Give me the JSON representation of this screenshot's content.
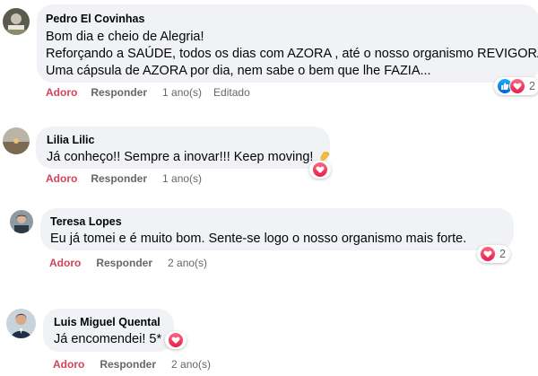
{
  "comments": [
    {
      "author": "Pedro El Covinhas",
      "lines": [
        "Bom dia e cheio de Alegria!",
        "Reforçando a SAÚDE, todos os dias com AZORA , até o nosso organismo REVIGORA...",
        "Uma cápsula de AZORA por dia, nem sabe o bem que lhe FAZIA..."
      ],
      "like_label": "Adoro",
      "reply_label": "Responder",
      "time": "1 ano(s)",
      "edited": "Editado",
      "reaction_count": "2",
      "reactions": [
        "like-icon",
        "love-icon"
      ]
    },
    {
      "author": "Lilia Lilic",
      "lines": [
        "Já conheço!! Sempre a inovar!!! Keep moving!"
      ],
      "like_label": "Adoro",
      "reply_label": "Responder",
      "time": "1 ano(s)",
      "reactions": [
        "love-icon"
      ]
    },
    {
      "author": "Teresa Lopes",
      "lines": [
        "Eu já tomei e é muito bom. Sente-se logo o nosso organismo mais forte."
      ],
      "like_label": "Adoro",
      "reply_label": "Responder",
      "time": "2 ano(s)",
      "reaction_count": "2",
      "reactions": [
        "love-icon"
      ]
    },
    {
      "author": "Luis Miguel Quental",
      "lines": [
        "Já encomendei! 5*"
      ],
      "like_label": "Adoro",
      "reply_label": "Responder",
      "time": "2 ano(s)",
      "reactions": [
        "love-icon"
      ]
    }
  ],
  "colors": {
    "bubble": "#f0f2f5",
    "like_action": "#d1435b",
    "secondary_text": "#65676b",
    "love": "#e61e4d",
    "like": "#0866ff"
  }
}
